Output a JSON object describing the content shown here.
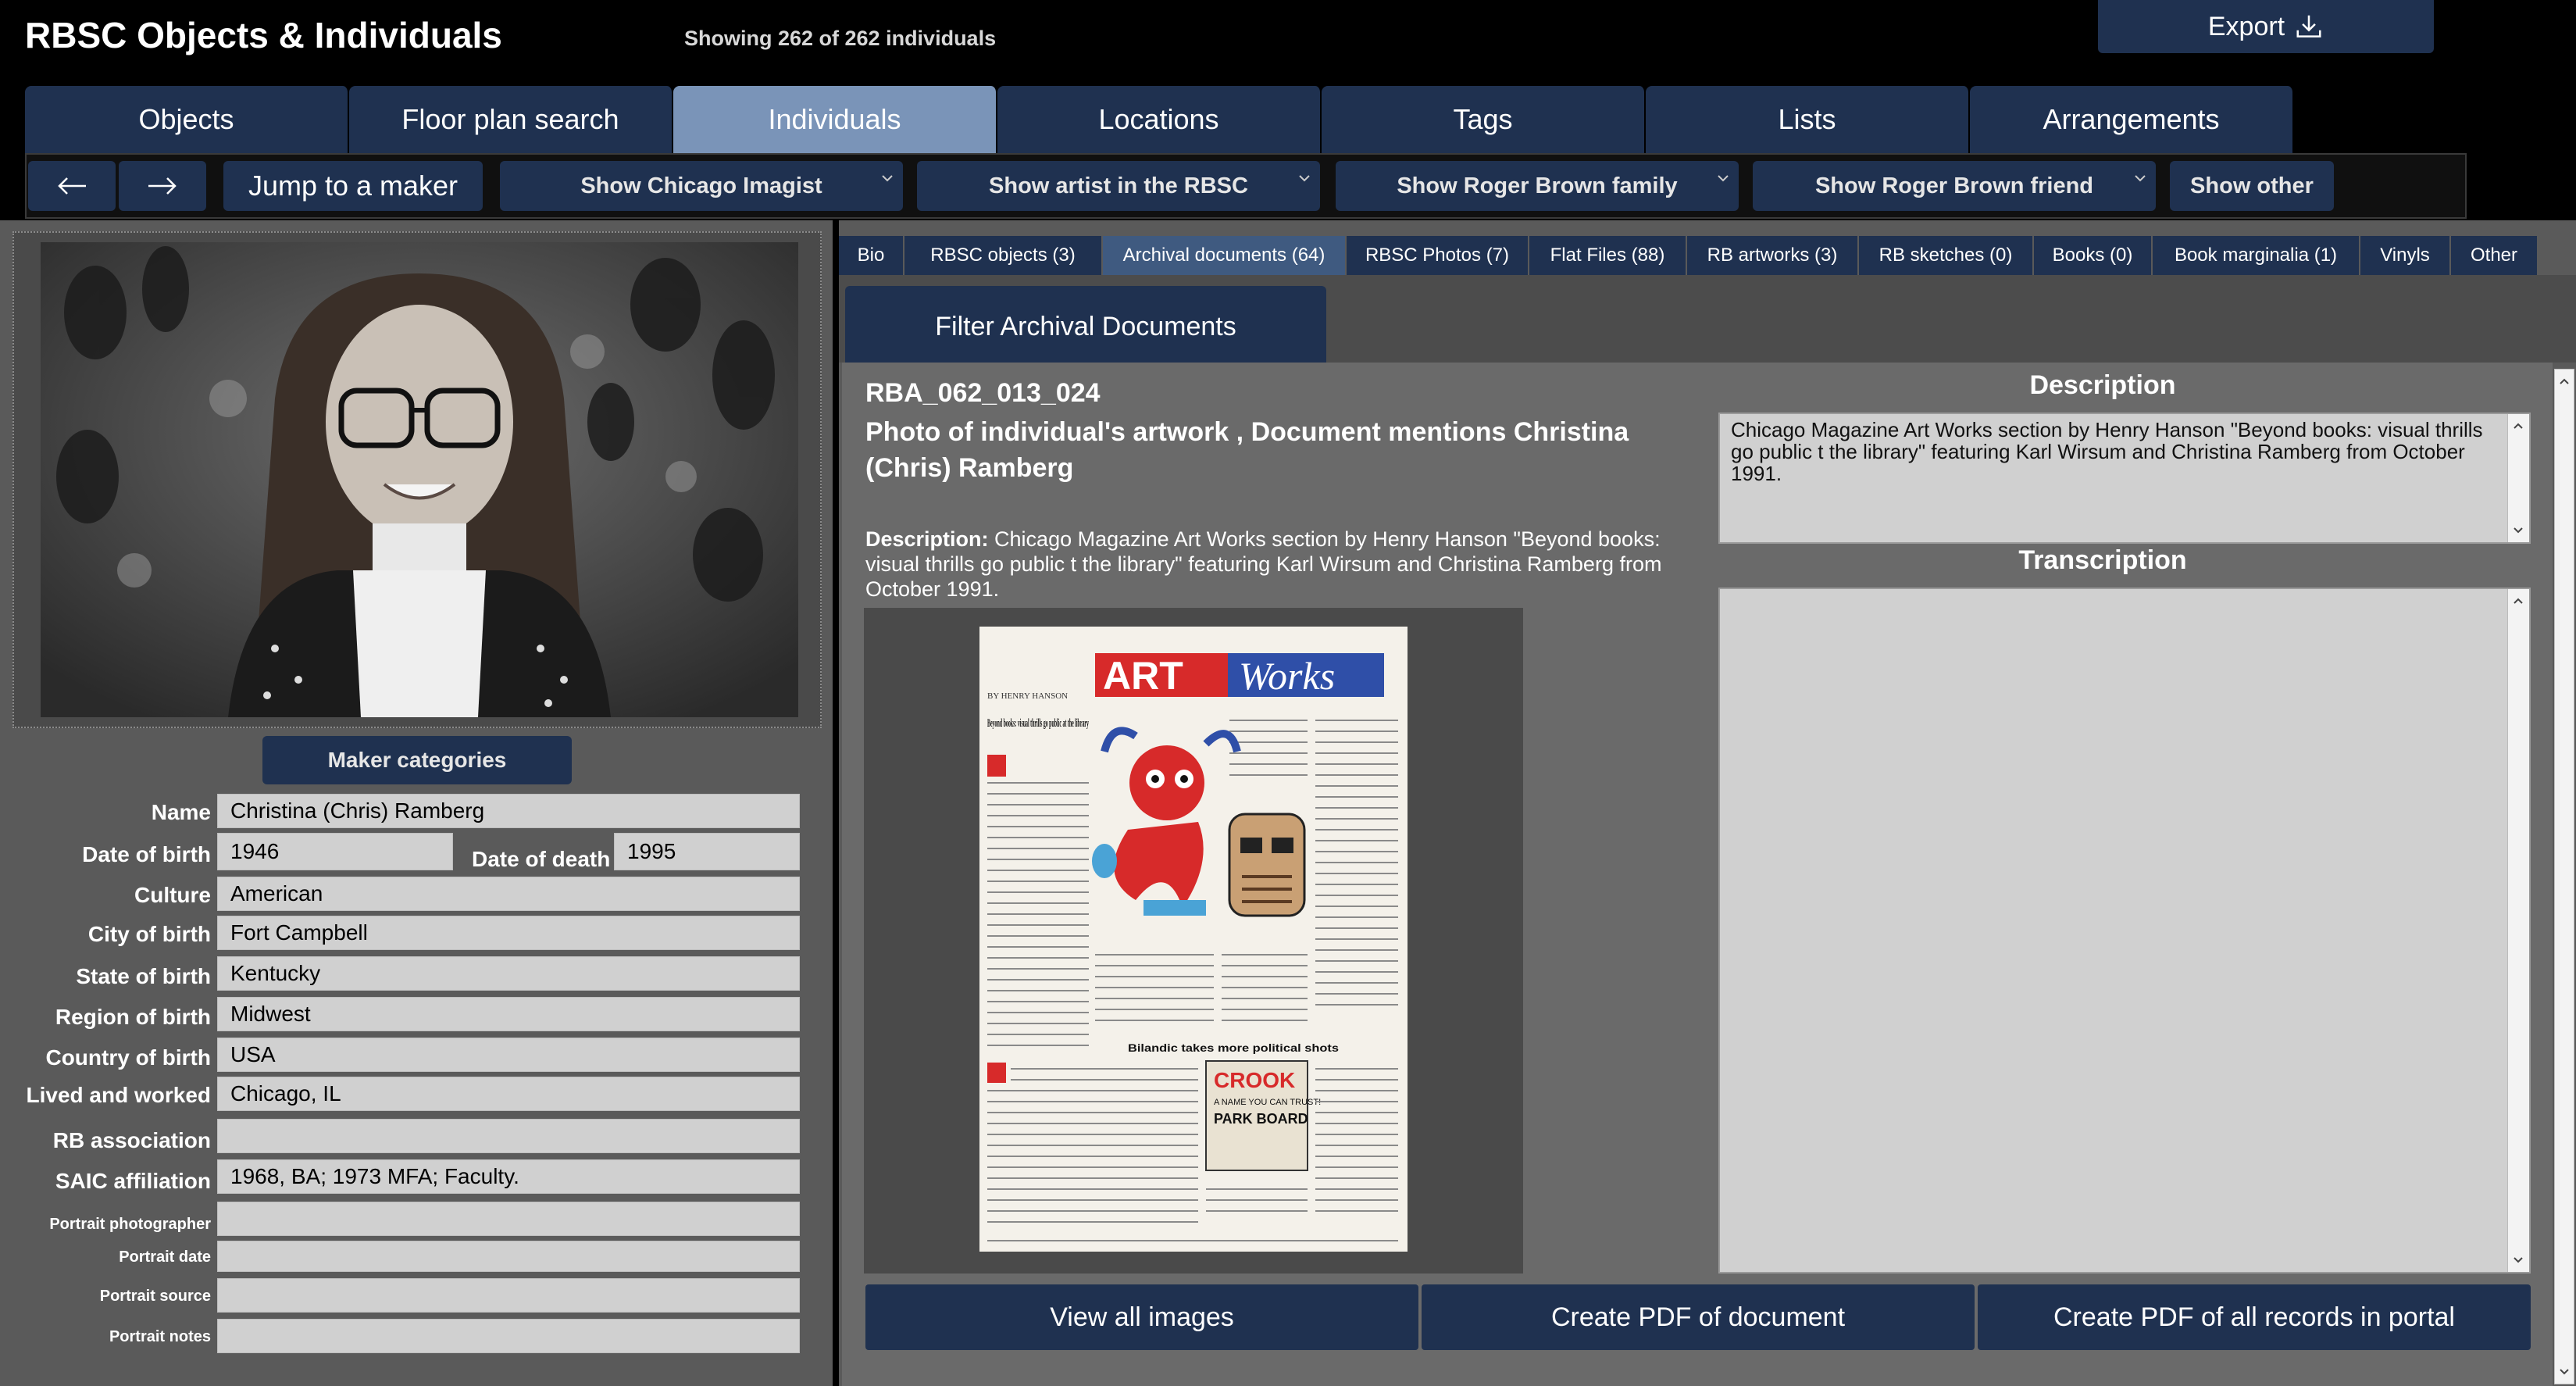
{
  "header": {
    "app_title": "RBSC Objects & Individuals",
    "count_text": "Showing 262 of 262 individuals",
    "export_label": "Export"
  },
  "nav_tabs": [
    {
      "label": "Objects"
    },
    {
      "label": "Floor plan search"
    },
    {
      "label": "Individuals"
    },
    {
      "label": "Locations"
    },
    {
      "label": "Tags"
    },
    {
      "label": "Lists"
    },
    {
      "label": "Arrangements"
    }
  ],
  "toolbar": {
    "jump_label": "Jump to a maker",
    "dropdowns": [
      {
        "label": "Show Chicago Imagist"
      },
      {
        "label": "Show artist in the RBSC"
      },
      {
        "label": "Show Roger Brown family"
      },
      {
        "label": "Show Roger Brown friend"
      }
    ],
    "show_other": "Show other"
  },
  "left": {
    "maker_categories": "Maker categories",
    "fields": {
      "name": {
        "label": "Name",
        "value": "Christina (Chris) Ramberg"
      },
      "dob": {
        "label": "Date of birth",
        "value": "1946"
      },
      "dod": {
        "label": "Date of death",
        "value": "1995"
      },
      "culture": {
        "label": "Culture",
        "value": "American"
      },
      "city": {
        "label": "City of birth",
        "value": "Fort Campbell"
      },
      "state": {
        "label": "State of birth",
        "value": "Kentucky"
      },
      "region": {
        "label": "Region of birth",
        "value": "Midwest"
      },
      "country": {
        "label": "Country of birth",
        "value": "USA"
      },
      "lived": {
        "label": "Lived and worked",
        "value": "Chicago, IL"
      },
      "rb": {
        "label": "RB association",
        "value": ""
      },
      "saic": {
        "label": "SAIC affiliation",
        "value": "1968, BA; 1973 MFA; Faculty."
      },
      "photographer": {
        "label": "Portrait photographer",
        "value": ""
      },
      "pdate": {
        "label": "Portrait date",
        "value": ""
      },
      "psource": {
        "label": "Portrait source",
        "value": ""
      },
      "pnotes": {
        "label": "Portrait notes",
        "value": ""
      }
    }
  },
  "sub_tabs": [
    {
      "label": "Bio"
    },
    {
      "label": "RBSC objects (3)"
    },
    {
      "label": "Archival documents (64)"
    },
    {
      "label": "RBSC Photos (7)"
    },
    {
      "label": "Flat Files (88)"
    },
    {
      "label": "RB artworks (3)"
    },
    {
      "label": "RB sketches (0)"
    },
    {
      "label": "Books (0)"
    },
    {
      "label": "Book marginalia (1)"
    },
    {
      "label": "Vinyls"
    },
    {
      "label": "Other"
    }
  ],
  "filter_label": "Filter Archival Documents",
  "record": {
    "id": "RBA_062_013_024",
    "title": "Photo of individual's artwork , Document mentions Christina (Chris) Ramberg",
    "desc_label": "Description:",
    "desc_text": "Chicago Magazine Art Works section by Henry Hanson \"Beyond books: visual thrills go public t the library\" featuring Karl Wirsum and Christina Ramberg from October 1991.",
    "description_heading": "Description",
    "description_box": "Chicago Magazine Art Works section by Henry Hanson \"Beyond books: visual thrills go public t the library\" featuring Karl Wirsum and Christina Ramberg from October 1991.",
    "transcription_heading": "Transcription",
    "transcription_box": ""
  },
  "magazine": {
    "art": "ART",
    "works": "Works",
    "byline": "BY HENRY HANSON",
    "head1": "Beyond books: visual thrills go public at the library",
    "head2": "Bilandic takes more political shots",
    "sign1": "CROOK",
    "sign2": "A NAME YOU CAN TRUST!",
    "sign3": "PARK BOARD"
  },
  "bottom_buttons": {
    "view_all": "View all images",
    "pdf_doc": "Create PDF of document",
    "pdf_all": "Create PDF of all records in portal"
  },
  "colors": {
    "button_navy": "#1f3150",
    "active_tab": "#7a94b8",
    "panel_gray": "#5a5a5a",
    "field_bg": "#d0d0d0"
  }
}
